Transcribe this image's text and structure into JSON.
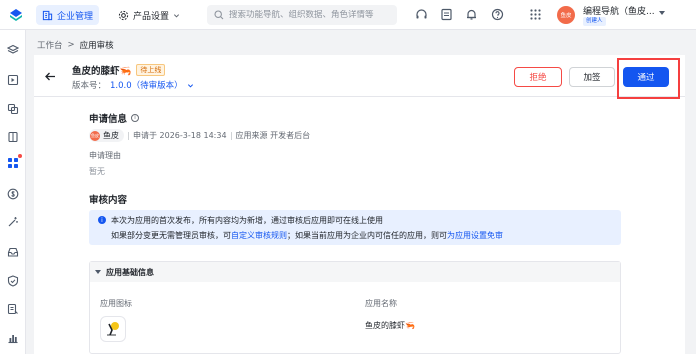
{
  "topbar": {
    "tabs": [
      {
        "label": "企业管理",
        "icon": "building-icon"
      },
      {
        "label": "产品设置",
        "icon": "settings-icon"
      }
    ],
    "search": {
      "placeholder": "搜索功能导航、组织数据、角色详情等"
    },
    "user": {
      "name": "编程导航（鱼皮...",
      "badge": "创建人",
      "avatar_text": "鱼皮"
    },
    "icons": [
      "headset-icon",
      "notes-icon",
      "bell-icon",
      "help-icon",
      "apps-grid-icon"
    ]
  },
  "sidebar": {
    "icons": [
      "layers-icon",
      "dashboard-icon",
      "copy-icon",
      "document-icon",
      "apps-icon",
      "dollar-icon",
      "magic-icon",
      "inbox-icon",
      "shield-icon",
      "report-icon",
      "chart-icon"
    ],
    "active_index": 4
  },
  "breadcrumb": {
    "root": "工作台",
    "separator": ">",
    "current": "应用审核"
  },
  "header": {
    "app_name": "鱼皮的膝虾🦐",
    "status": "待上线",
    "version_label": "版本号：",
    "version_value": "1.0.0（待审版本）",
    "buttons": {
      "reject": "拒绝",
      "sign": "加签",
      "pass": "通过"
    }
  },
  "apply": {
    "title": "申请信息",
    "applicant": "鱼皮",
    "applicant_avatar": "鱼皮",
    "applied_at": "申请于 2026-3-18 14:34",
    "source": "应用来源 开发者后台",
    "reason_label": "申请理由",
    "reason_value": "暂无"
  },
  "review": {
    "title": "审核内容",
    "notice_line1": "本次为应用的首次发布，所有内容均为新增，通过审核后应用即可在线上使用",
    "notice_line2_a": "如果部分变更无需管理员审核，可",
    "notice_link1": "自定义审核规则",
    "notice_line2_b": "；如果当前应用为企业内可信任的应用，则可",
    "notice_link2": "为应用设置免审"
  },
  "basic_info": {
    "section_title": "应用基础信息",
    "icon_label": "应用图标",
    "name_label": "应用名称",
    "name_value": "鱼皮的膝虾🦐"
  },
  "colors": {
    "accent": "#1456f0",
    "danger": "#f54a45",
    "warning": "#d46b08"
  }
}
